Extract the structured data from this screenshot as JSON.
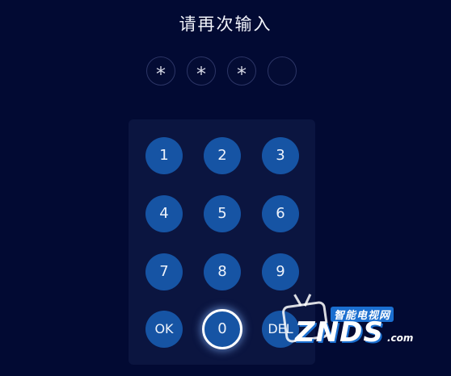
{
  "title": "请再次输入",
  "pin_dots": [
    "*",
    "*",
    "*",
    ""
  ],
  "keypad": {
    "keys": [
      "1",
      "2",
      "3",
      "4",
      "5",
      "6",
      "7",
      "8",
      "9",
      "OK",
      "0",
      "DEL"
    ],
    "focused_key": "0"
  },
  "watermark": {
    "subtitle": "智能电视网",
    "logo": "ZNDS",
    "domain": ".com"
  },
  "colors": {
    "background": "#020a33",
    "keypad_panel": "#0b1540",
    "key": "#1654a4",
    "focus_ring": "#ffffff"
  }
}
